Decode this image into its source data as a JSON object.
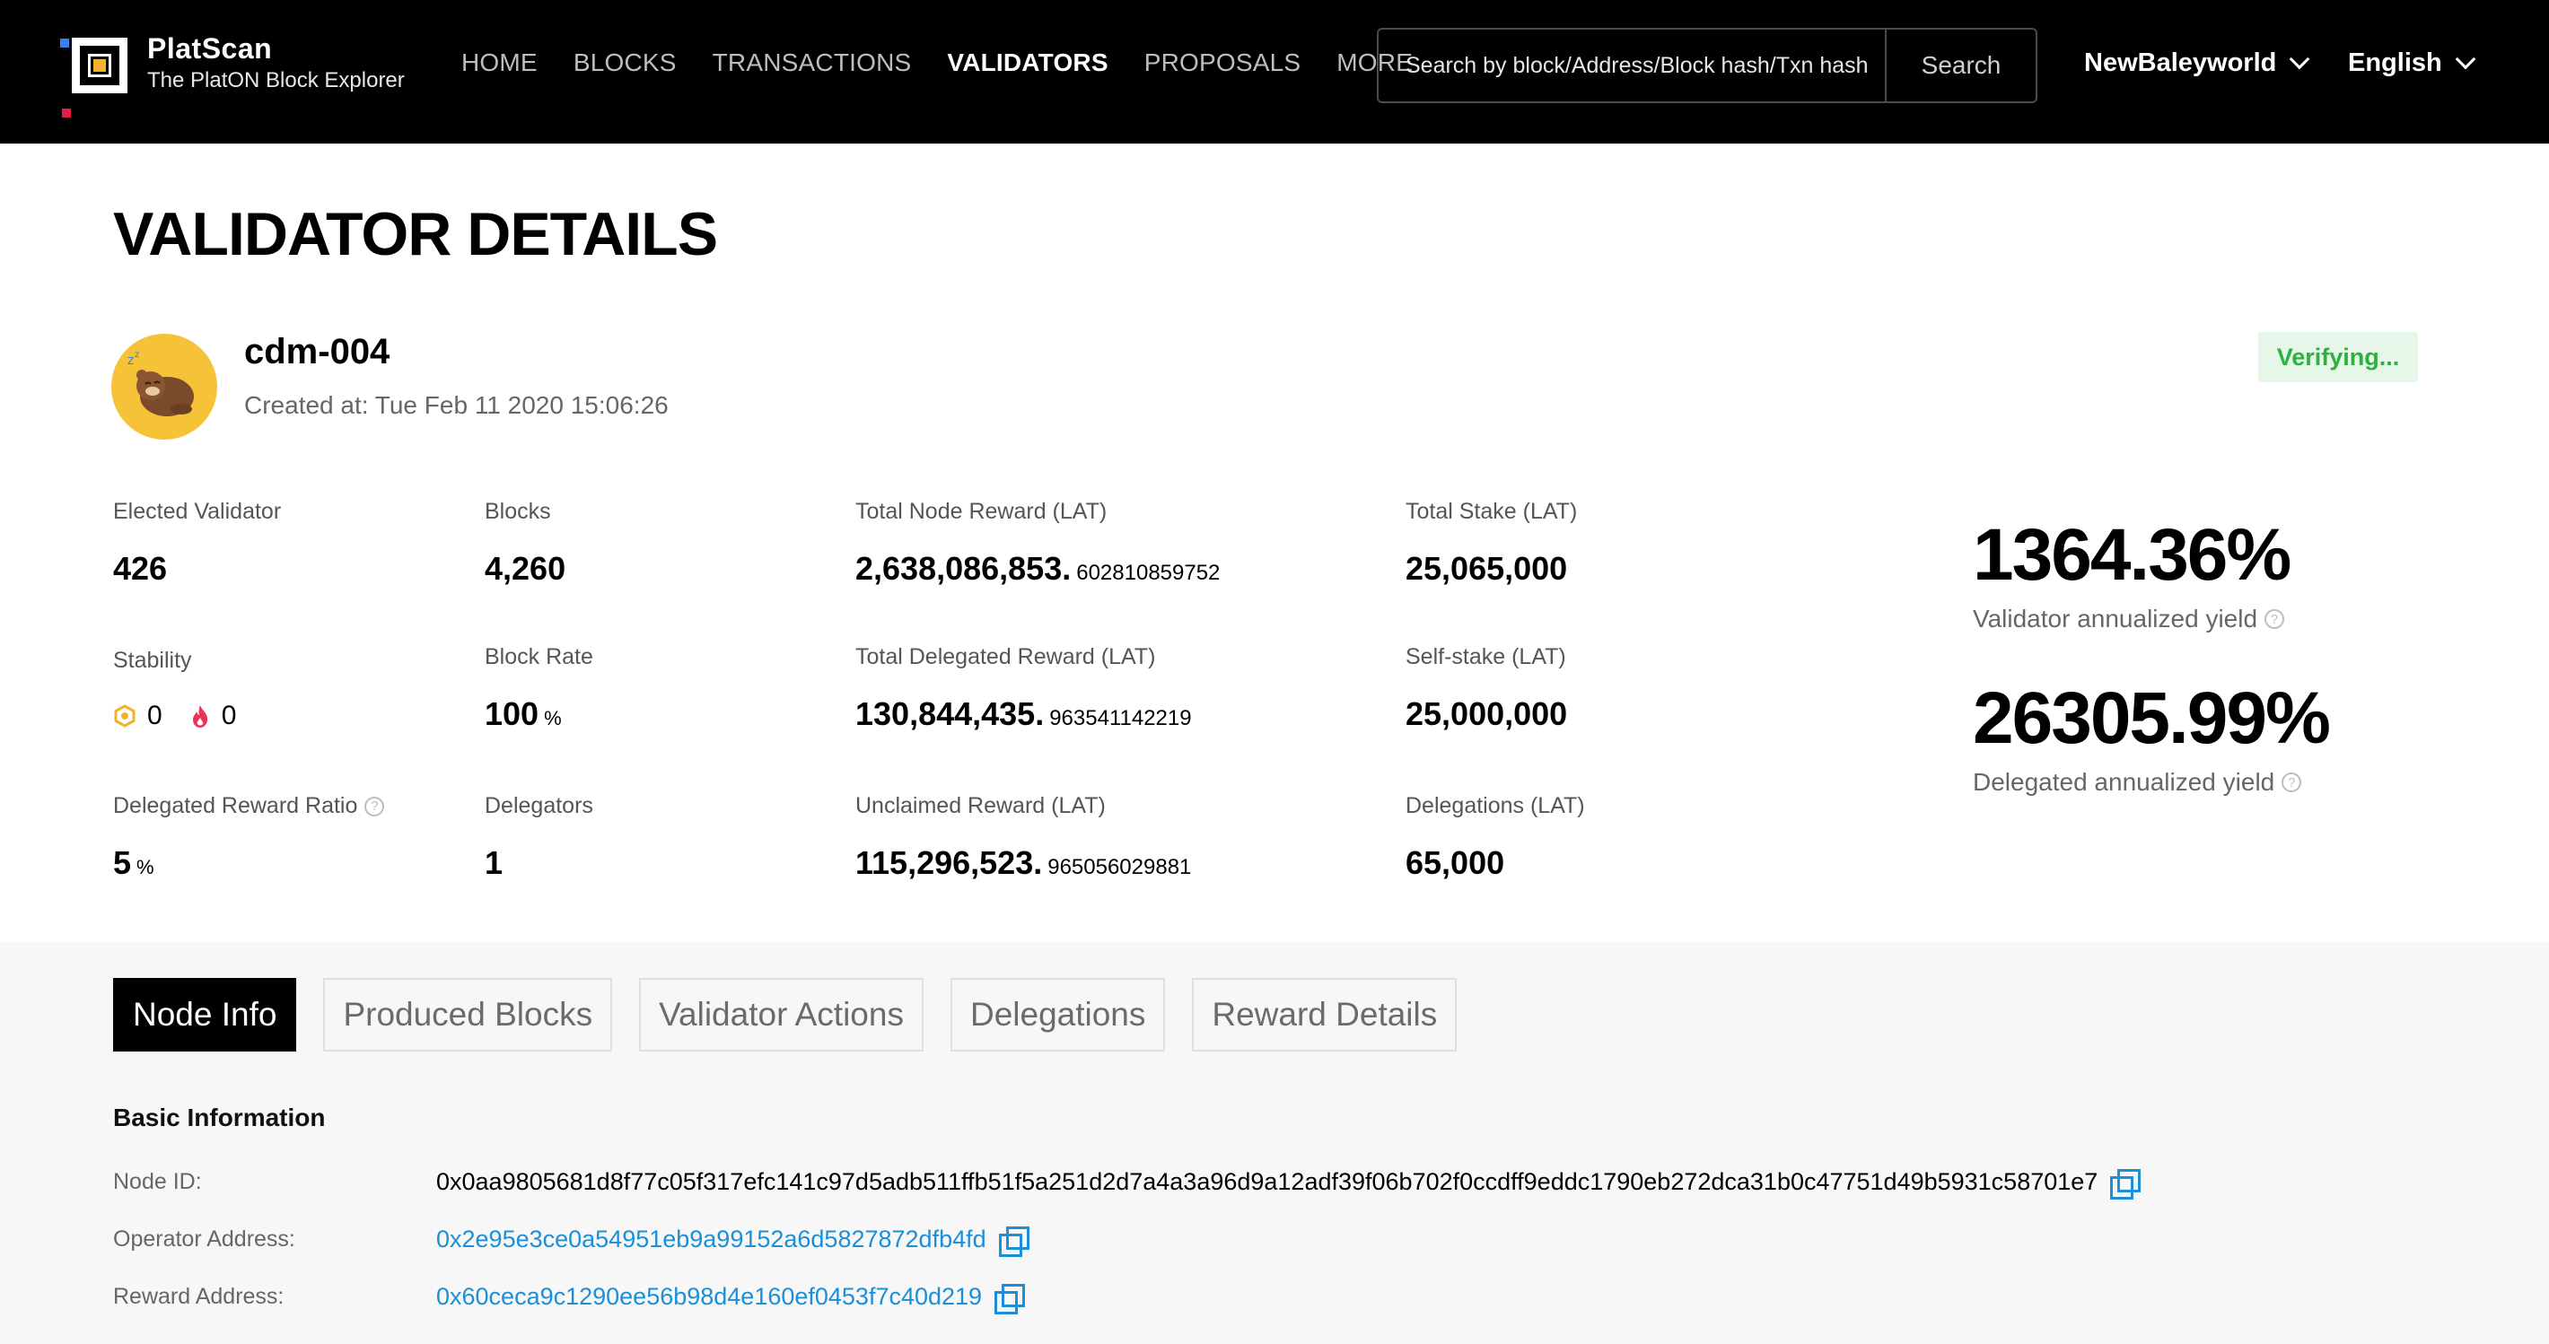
{
  "header": {
    "brand": "PlatScan",
    "tagline": "The PlatON Block Explorer",
    "nav": [
      "HOME",
      "BLOCKS",
      "TRANSACTIONS",
      "VALIDATORS",
      "PROPOSALS",
      "MORE"
    ],
    "active_nav": "VALIDATORS",
    "search": {
      "placeholder": "Search by block/Address/Block hash/Txn hash",
      "button": "Search"
    },
    "network": "NewBaleyworld",
    "language": "English"
  },
  "page": {
    "title": "VALIDATOR DETAILS"
  },
  "validator": {
    "name": "cdm-004",
    "created": "Created at: Tue Feb 11 2020 15:06:26",
    "status": "Verifying..."
  },
  "stats": {
    "elected_validator": {
      "label": "Elected Validator",
      "value": "426"
    },
    "blocks": {
      "label": "Blocks",
      "value": "4,260"
    },
    "total_node_reward": {
      "label": "Total Node Reward (LAT)",
      "value": "2,638,086,853.",
      "decimals": "602810859752"
    },
    "total_stake": {
      "label": "Total Stake (LAT)",
      "value": "25,065,000"
    },
    "stability": {
      "label": "Stability",
      "low_block": "0",
      "slash": "0"
    },
    "block_rate": {
      "label": "Block Rate",
      "value": "100",
      "unit": "%"
    },
    "total_delegated_reward": {
      "label": "Total Delegated Reward (LAT)",
      "value": "130,844,435.",
      "decimals": "963541142219"
    },
    "self_stake": {
      "label": "Self-stake (LAT)",
      "value": "25,000,000"
    },
    "delegated_reward_ratio": {
      "label": "Delegated Reward Ratio",
      "value": "5",
      "unit": "%"
    },
    "delegators": {
      "label": "Delegators",
      "value": "1"
    },
    "unclaimed_reward": {
      "label": "Unclaimed Reward (LAT)",
      "value": "115,296,523.",
      "decimals": "965056029881"
    },
    "delegations": {
      "label": "Delegations (LAT)",
      "value": "65,000"
    }
  },
  "yields": {
    "validator": {
      "value": "1364.36%",
      "label": "Validator annualized yield"
    },
    "delegated": {
      "value": "26305.99%",
      "label": "Delegated annualized yield"
    }
  },
  "tabs": [
    "Node Info",
    "Produced Blocks",
    "Validator Actions",
    "Delegations",
    "Reward Details"
  ],
  "active_tab": "Node Info",
  "basic_info": {
    "title": "Basic Information",
    "node_id": {
      "label": "Node ID:",
      "value": "0x0aa9805681d8f77c05f317efc141c97d5adb511ffb51f5a251d2d7a4a3a96d9a12adf39f06b702f0ccdff9eddc1790eb272dca31b0c47751d49b5931c58701e7"
    },
    "operator_address": {
      "label": "Operator Address:",
      "value": "0x2e95e3ce0a54951eb9a99152a6d5827872dfb4fd"
    },
    "reward_address": {
      "label": "Reward Address:",
      "value": "0x60ceca9c1290ee56b98d4e160ef0453f7c40d219"
    }
  },
  "colors": {
    "header_bg": "#000000",
    "accent_logo": "#f3b12c",
    "status_green": "#2cb140",
    "link_blue": "#1b8fd8"
  }
}
